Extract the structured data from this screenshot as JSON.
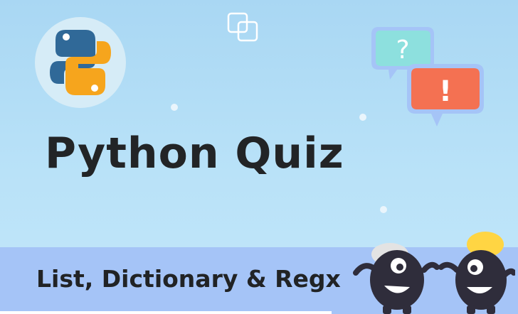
{
  "banner": {
    "title": "Python Quiz",
    "subtitle": "List, Dictionary & Regx",
    "question_mark": "?",
    "exclamation_mark": "!"
  },
  "colors": {
    "background": "#b9e2f8",
    "band": "#a5c4f7",
    "python_blue": "#306998",
    "python_yellow": "#f6a51d",
    "bubble_teal": "#8de0de",
    "bubble_red": "#f47152",
    "mascot_body": "#2f2d3b",
    "hat_grey": "#e3e3e3",
    "hat_yellow": "#ffd543"
  },
  "icons": [
    "python-logo-icon",
    "overlapping-squares-icon",
    "question-bubble-icon",
    "exclamation-bubble-icon"
  ]
}
